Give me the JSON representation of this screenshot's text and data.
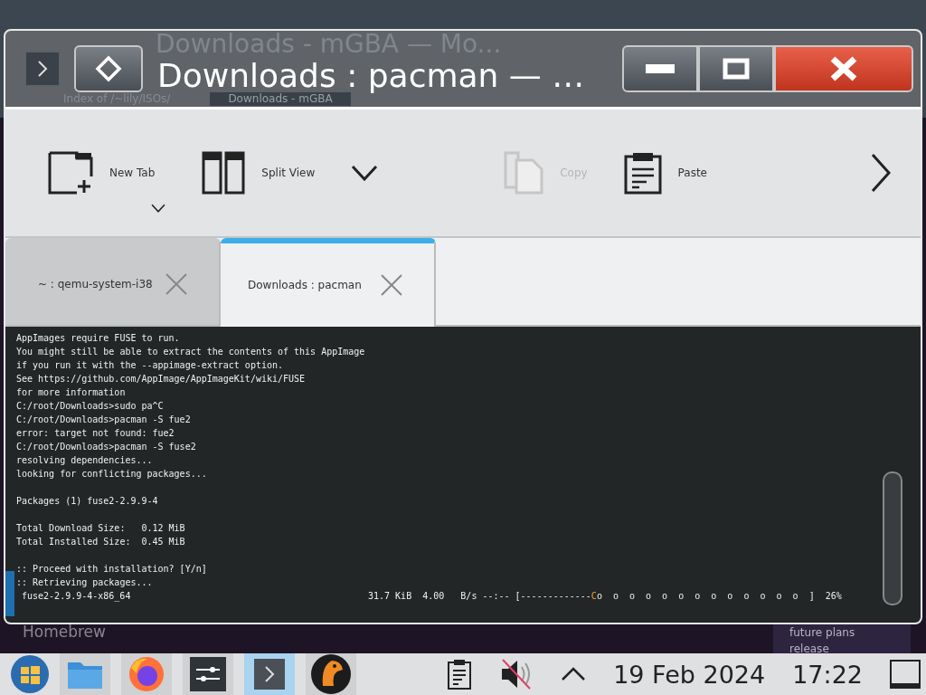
{
  "background_window": {
    "title": "Downloads - mGBA — Mo...",
    "tabs": [
      {
        "label": "Index of /~lily/ISOs/",
        "selected": false
      },
      {
        "label": "Downloads - mGBA",
        "selected": true
      }
    ]
  },
  "background_page": {
    "heading": "Homebrew",
    "sidebar_items": [
      "future plans",
      "release"
    ]
  },
  "window": {
    "title": "Downloads : pacman — …"
  },
  "toolbar": [
    {
      "kind": "new-tab",
      "label": "New Tab",
      "disabled": false
    },
    {
      "kind": "split-view",
      "label": "Split View",
      "disabled": false
    },
    {
      "kind": "copy",
      "label": "Copy",
      "disabled": true
    },
    {
      "kind": "paste",
      "label": "Paste",
      "disabled": false
    }
  ],
  "tabs": [
    {
      "label": "~ : qemu-system-i38",
      "selected": false
    },
    {
      "label": "Downloads : pacman",
      "selected": true
    }
  ],
  "terminal": {
    "blocks": [
      [
        "AppImages require FUSE to run.",
        "You might still be able to extract the contents of this AppImage",
        "if you run it with the --appimage-extract option.",
        "See https://github.com/AppImage/AppImageKit/wiki/FUSE",
        "for more information",
        "C:/root/Downloads>sudo pa^C",
        "C:/root/Downloads>pacman -S fue2",
        "error: target not found: fue2",
        "C:/root/Downloads>pacman -S fuse2",
        "resolving dependencies...",
        "looking for conflicting packages..."
      ],
      [
        "Packages (1) fuse2-2.9.9-4"
      ],
      [
        "Total Download Size:   0.12 MiB",
        "Total Installed Size:  0.45 MiB"
      ],
      [
        ":: Proceed with installation? [Y/n]",
        ":: Retrieving packages..."
      ]
    ],
    "progress": {
      "name": "fuse2-2.9.9-4-x86_64",
      "stats": "31.7 KiB  4.00   B/s --:-- [-------------",
      "pacman": "C",
      "dots": "o  o  o  o  o  o  o  o  o  o  o  o  o  ]",
      "percent": "26%"
    }
  },
  "taskbar": {
    "apps": [
      {
        "kind": "files",
        "active": false
      },
      {
        "kind": "browser",
        "active": false
      },
      {
        "kind": "settings",
        "active": false
      },
      {
        "kind": "terminal",
        "active": true
      },
      {
        "kind": "bird",
        "active": false
      }
    ],
    "date": "19 Feb 2024",
    "time": "17:22"
  }
}
